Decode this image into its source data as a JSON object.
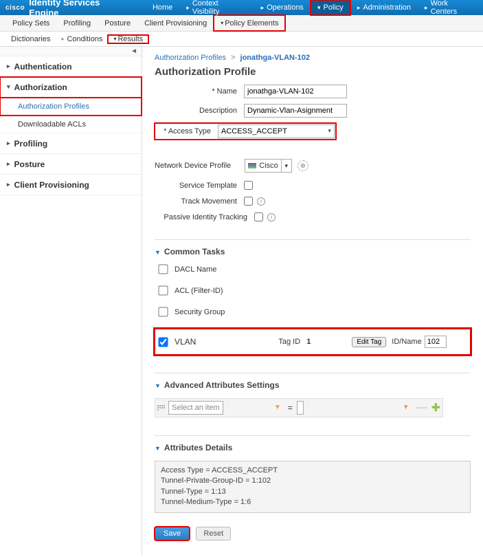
{
  "brand": {
    "logo": "cisco",
    "productName": "Identity Services Engine"
  },
  "topNav": {
    "home": "Home",
    "contextVisibility": "Context Visibility",
    "operations": "Operations",
    "policy": "Policy",
    "administration": "Administration",
    "workCenters": "Work Centers"
  },
  "subNav": {
    "policySets": "Policy Sets",
    "profiling": "Profiling",
    "posture": "Posture",
    "clientProvisioning": "Client Provisioning",
    "policyElements": "Policy Elements"
  },
  "tertNav": {
    "dictionaries": "Dictionaries",
    "conditions": "Conditions",
    "results": "Results"
  },
  "sidebar": {
    "items": [
      "Authentication",
      "Authorization",
      "Profiling",
      "Posture",
      "Client Provisioning"
    ],
    "authorizationSub": {
      "profiles": "Authorization Profiles",
      "dacls": "Downloadable ACLs"
    }
  },
  "breadcrumb": {
    "root": "Authorization Profiles",
    "current": "jonathga-VLAN-102"
  },
  "pageTitle": "Authorization Profile",
  "form": {
    "nameLabel": "* Name",
    "nameValue": "jonathga-VLAN-102",
    "descriptionLabel": "Description",
    "descriptionValue": "Dynamic-Vlan-Asignment",
    "accessTypeLabel": "* Access Type",
    "accessTypeValue": "ACCESS_ACCEPT",
    "ndpLabel": "Network Device Profile",
    "ndpValue": "Cisco",
    "serviceTemplateLabel": "Service Template",
    "trackMovementLabel": "Track Movement",
    "passiveIdentityLabel": "Passive Identity Tracking"
  },
  "commonTasks": {
    "heading": "Common Tasks",
    "daclName": "DACL Name",
    "aclFilterId": "ACL (Filter-ID)",
    "securityGroup": "Security Group",
    "vlanLabel": "VLAN",
    "tagIdLabel": "Tag ID",
    "tagIdValue": "1",
    "editTag": "Edit Tag",
    "idNameLabel": "ID/Name",
    "idNameValue": "102"
  },
  "advanced": {
    "heading": "Advanced Attributes Settings",
    "selectPlaceholder": "Select an item"
  },
  "attributesDetails": {
    "heading": "Attributes Details",
    "text": "Access Type = ACCESS_ACCEPT\nTunnel-Private-Group-ID = 1:102\nTunnel-Type = 1:13\nTunnel-Medium-Type = 1:6"
  },
  "buttons": {
    "save": "Save",
    "reset": "Reset"
  }
}
